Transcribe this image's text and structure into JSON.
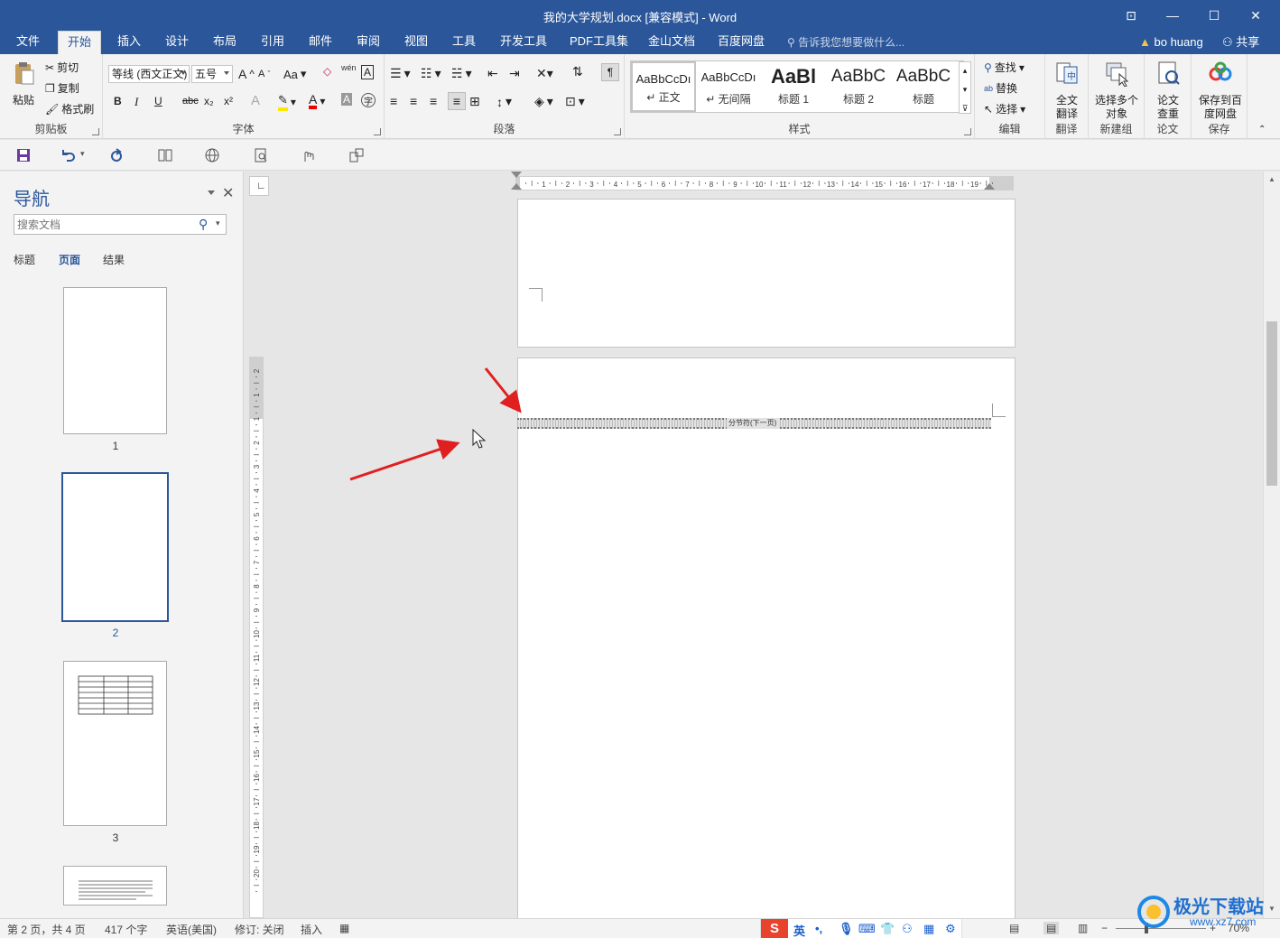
{
  "window": {
    "title": "我的大学规划.docx [兼容模式] - Word",
    "controls": {
      "ribbon_display": "⊡",
      "minimize": "—",
      "maximize": "☐",
      "close": "✕"
    }
  },
  "tabs": [
    "文件",
    "开始",
    "插入",
    "设计",
    "布局",
    "引用",
    "邮件",
    "审阅",
    "视图",
    "工具",
    "开发工具",
    "PDF工具集",
    "金山文档",
    "百度网盘"
  ],
  "active_tab": "开始",
  "tell_me": "告诉我您想要做什么...",
  "user": "bo huang",
  "share": "共享",
  "ribbon": {
    "clipboard": {
      "paste": "粘贴",
      "cut": "剪切",
      "copy": "复制",
      "format_painter": "格式刷",
      "label": "剪贴板"
    },
    "font": {
      "font_name": "等线 (西文正文)",
      "font_size": "五号",
      "label": "字体",
      "bold": "B",
      "italic": "I",
      "underline": "U",
      "strike": "abc",
      "sub": "x₂",
      "sup": "x²",
      "grow": "A",
      "shrink": "A",
      "case": "Aa",
      "wen": "wén",
      "border_char": "A"
    },
    "paragraph": {
      "label": "段落"
    },
    "styles": {
      "items": [
        {
          "sample": "AaBbCcDı",
          "name": "↵ 正文"
        },
        {
          "sample": "AaBbCcDı",
          "name": "↵ 无间隔"
        },
        {
          "sample": "AaBl",
          "name": "标题 1"
        },
        {
          "sample": "AaBbC",
          "name": "标题 2"
        },
        {
          "sample": "AaBbC",
          "name": "标题"
        }
      ],
      "label": "样式"
    },
    "editing": {
      "find": "查找",
      "replace": "替换",
      "select": "选择",
      "label": "编辑"
    },
    "translate": {
      "button": "全文翻译",
      "label": "翻译"
    },
    "newgroup": {
      "button": "选择多个对象",
      "label": "新建组"
    },
    "paper": {
      "button": "论文查重",
      "label": "论文"
    },
    "save": {
      "button": "保存到百度网盘",
      "label": "保存"
    }
  },
  "nav": {
    "title": "导航",
    "search_placeholder": "搜索文档",
    "tabs": [
      "标题",
      "页面",
      "结果"
    ],
    "active_tab": "页面",
    "pages": [
      "1",
      "2",
      "3"
    ]
  },
  "document": {
    "section_break": "分节符(下一页)",
    "hruler_ticks": [
      "1",
      "2",
      "3",
      "4",
      "5",
      "6",
      "7",
      "8",
      "9",
      "10",
      "11",
      "12",
      "13",
      "14",
      "15",
      "16",
      "17",
      "18",
      "19"
    ],
    "vruler_ticks": [
      "2",
      "1",
      "1",
      "2",
      "3",
      "4",
      "5",
      "6",
      "7",
      "8",
      "9",
      "10",
      "11",
      "12",
      "13",
      "14",
      "15",
      "16",
      "17",
      "18",
      "19",
      "20"
    ]
  },
  "status": {
    "page": "第 2 页，共 4 页",
    "words": "417 个字",
    "language": "英语(美国)",
    "track": "修订: 关闭",
    "mode": "插入",
    "zoom": "70%",
    "ime": "英"
  },
  "watermark": {
    "text": "极光下载站",
    "url": "www.xz7.com"
  },
  "colors": {
    "accent": "#2b579a",
    "arrow": "#e02020"
  }
}
